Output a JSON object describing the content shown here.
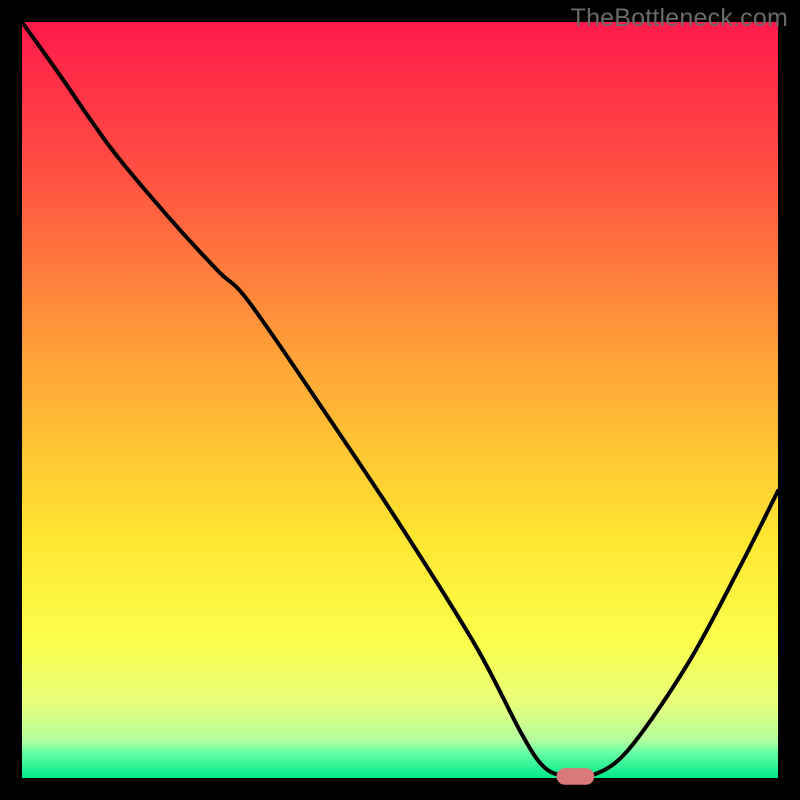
{
  "watermark": "TheBottleneck.com",
  "chart_data": {
    "type": "line",
    "title": "",
    "xlabel": "",
    "ylabel": "",
    "xlim": [
      0,
      100
    ],
    "ylim": [
      0,
      100
    ],
    "gradient_stops": [
      {
        "offset": 0.0,
        "color": "#ff1a4a"
      },
      {
        "offset": 0.2,
        "color": "#ff5042"
      },
      {
        "offset": 0.45,
        "color": "#ffa537"
      },
      {
        "offset": 0.68,
        "color": "#ffe531"
      },
      {
        "offset": 0.82,
        "color": "#fbff4c"
      },
      {
        "offset": 0.9,
        "color": "#e8ff7a"
      },
      {
        "offset": 0.95,
        "color": "#b4ff9e"
      },
      {
        "offset": 0.965,
        "color": "#6effa6"
      },
      {
        "offset": 1.0,
        "color": "#00e98a"
      }
    ],
    "series": [
      {
        "name": "bottleneck-curve",
        "x": [
          0.0,
          5.0,
          12.0,
          20.0,
          26.0,
          30.0,
          40.0,
          50.0,
          60.0,
          66.0,
          69.0,
          72.0,
          75.0,
          80.0,
          88.0,
          95.0,
          100.0
        ],
        "y": [
          100.0,
          93.0,
          83.0,
          73.5,
          67.0,
          63.0,
          48.5,
          33.5,
          17.5,
          6.0,
          1.5,
          0.2,
          0.2,
          3.5,
          15.0,
          28.0,
          38.0
        ]
      }
    ],
    "marker": {
      "name": "optimal-point",
      "x": 73.2,
      "y": 0.2,
      "rx": 2.5,
      "ry": 1.1,
      "color": "#d9797a"
    },
    "axes": {
      "stroke": "#000000",
      "stroke_width": 22
    }
  }
}
